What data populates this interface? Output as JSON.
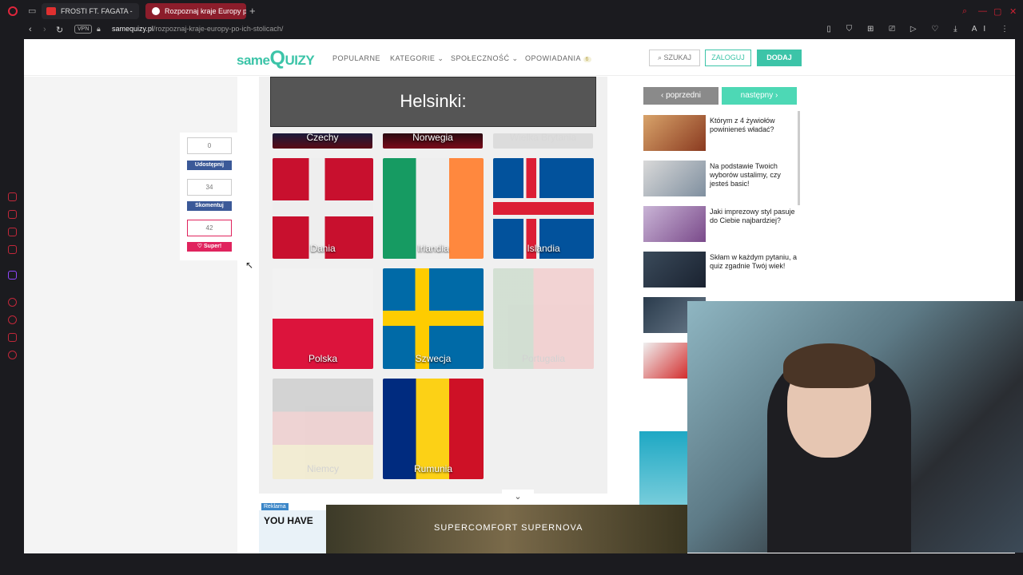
{
  "browser": {
    "tabs": [
      {
        "label": "FROSTI FT. FAGATA - "
      },
      {
        "label": "Rozpoznaj kraje Europy po"
      }
    ],
    "vpn": "VPN",
    "url_domain": "samequizy.pl",
    "url_path": "/rozpoznaj-kraje-europy-po-ich-stolicach/",
    "ai_label": "AI"
  },
  "header": {
    "logo_same": "same",
    "logo_q": "Q",
    "logo_uizy": "UIZY",
    "menu": [
      "POPULARNE",
      "KATEGORIE ⌄",
      "SPOŁECZNOŚĆ ⌄",
      "OPOWIADANIA"
    ],
    "stories_badge": "6",
    "search": "⌕ SZUKAJ",
    "login": "ZALOGUJ",
    "add": "DODAJ"
  },
  "social": {
    "share_count": "0",
    "share_label": "Udostępnij",
    "comment_count": "34",
    "comment_label": "Skomentuj",
    "super_count": "42",
    "super_label": "♡ Super!"
  },
  "quiz": {
    "question": "Helsinki:",
    "top_row": [
      "Czechy",
      "Norwegia",
      "Wielka Brytania"
    ],
    "answers": [
      {
        "label": "Dania",
        "faded": false
      },
      {
        "label": "Irlandia",
        "faded": false
      },
      {
        "label": "Islandia",
        "faded": false
      },
      {
        "label": "Polska",
        "faded": false
      },
      {
        "label": "Szwecja",
        "faded": false
      },
      {
        "label": "Portugalia",
        "faded": true
      },
      {
        "label": "Niemcy",
        "faded": true
      },
      {
        "label": "Rumunia",
        "faded": false
      }
    ]
  },
  "related": {
    "prev": "‹   poprzedni",
    "next": "następny   ›",
    "items": [
      {
        "title": "Którym z 4 żywiołów powinieneś władać?"
      },
      {
        "title": "Na podstawie Twoich wyborów ustalimy, czy jesteś basic!"
      },
      {
        "title": "Jaki imprezowy styl pasuje do Ciebie najbardziej?"
      },
      {
        "title": "Skłam w każdym pytaniu, a quiz zgadnie Twój wiek!"
      }
    ]
  },
  "ads": {
    "reklama": "Reklama",
    "left_text": "YOU HAVE",
    "banner": "SUPERCOMFORT SUPERNOVA",
    "collapse": "⌄"
  }
}
